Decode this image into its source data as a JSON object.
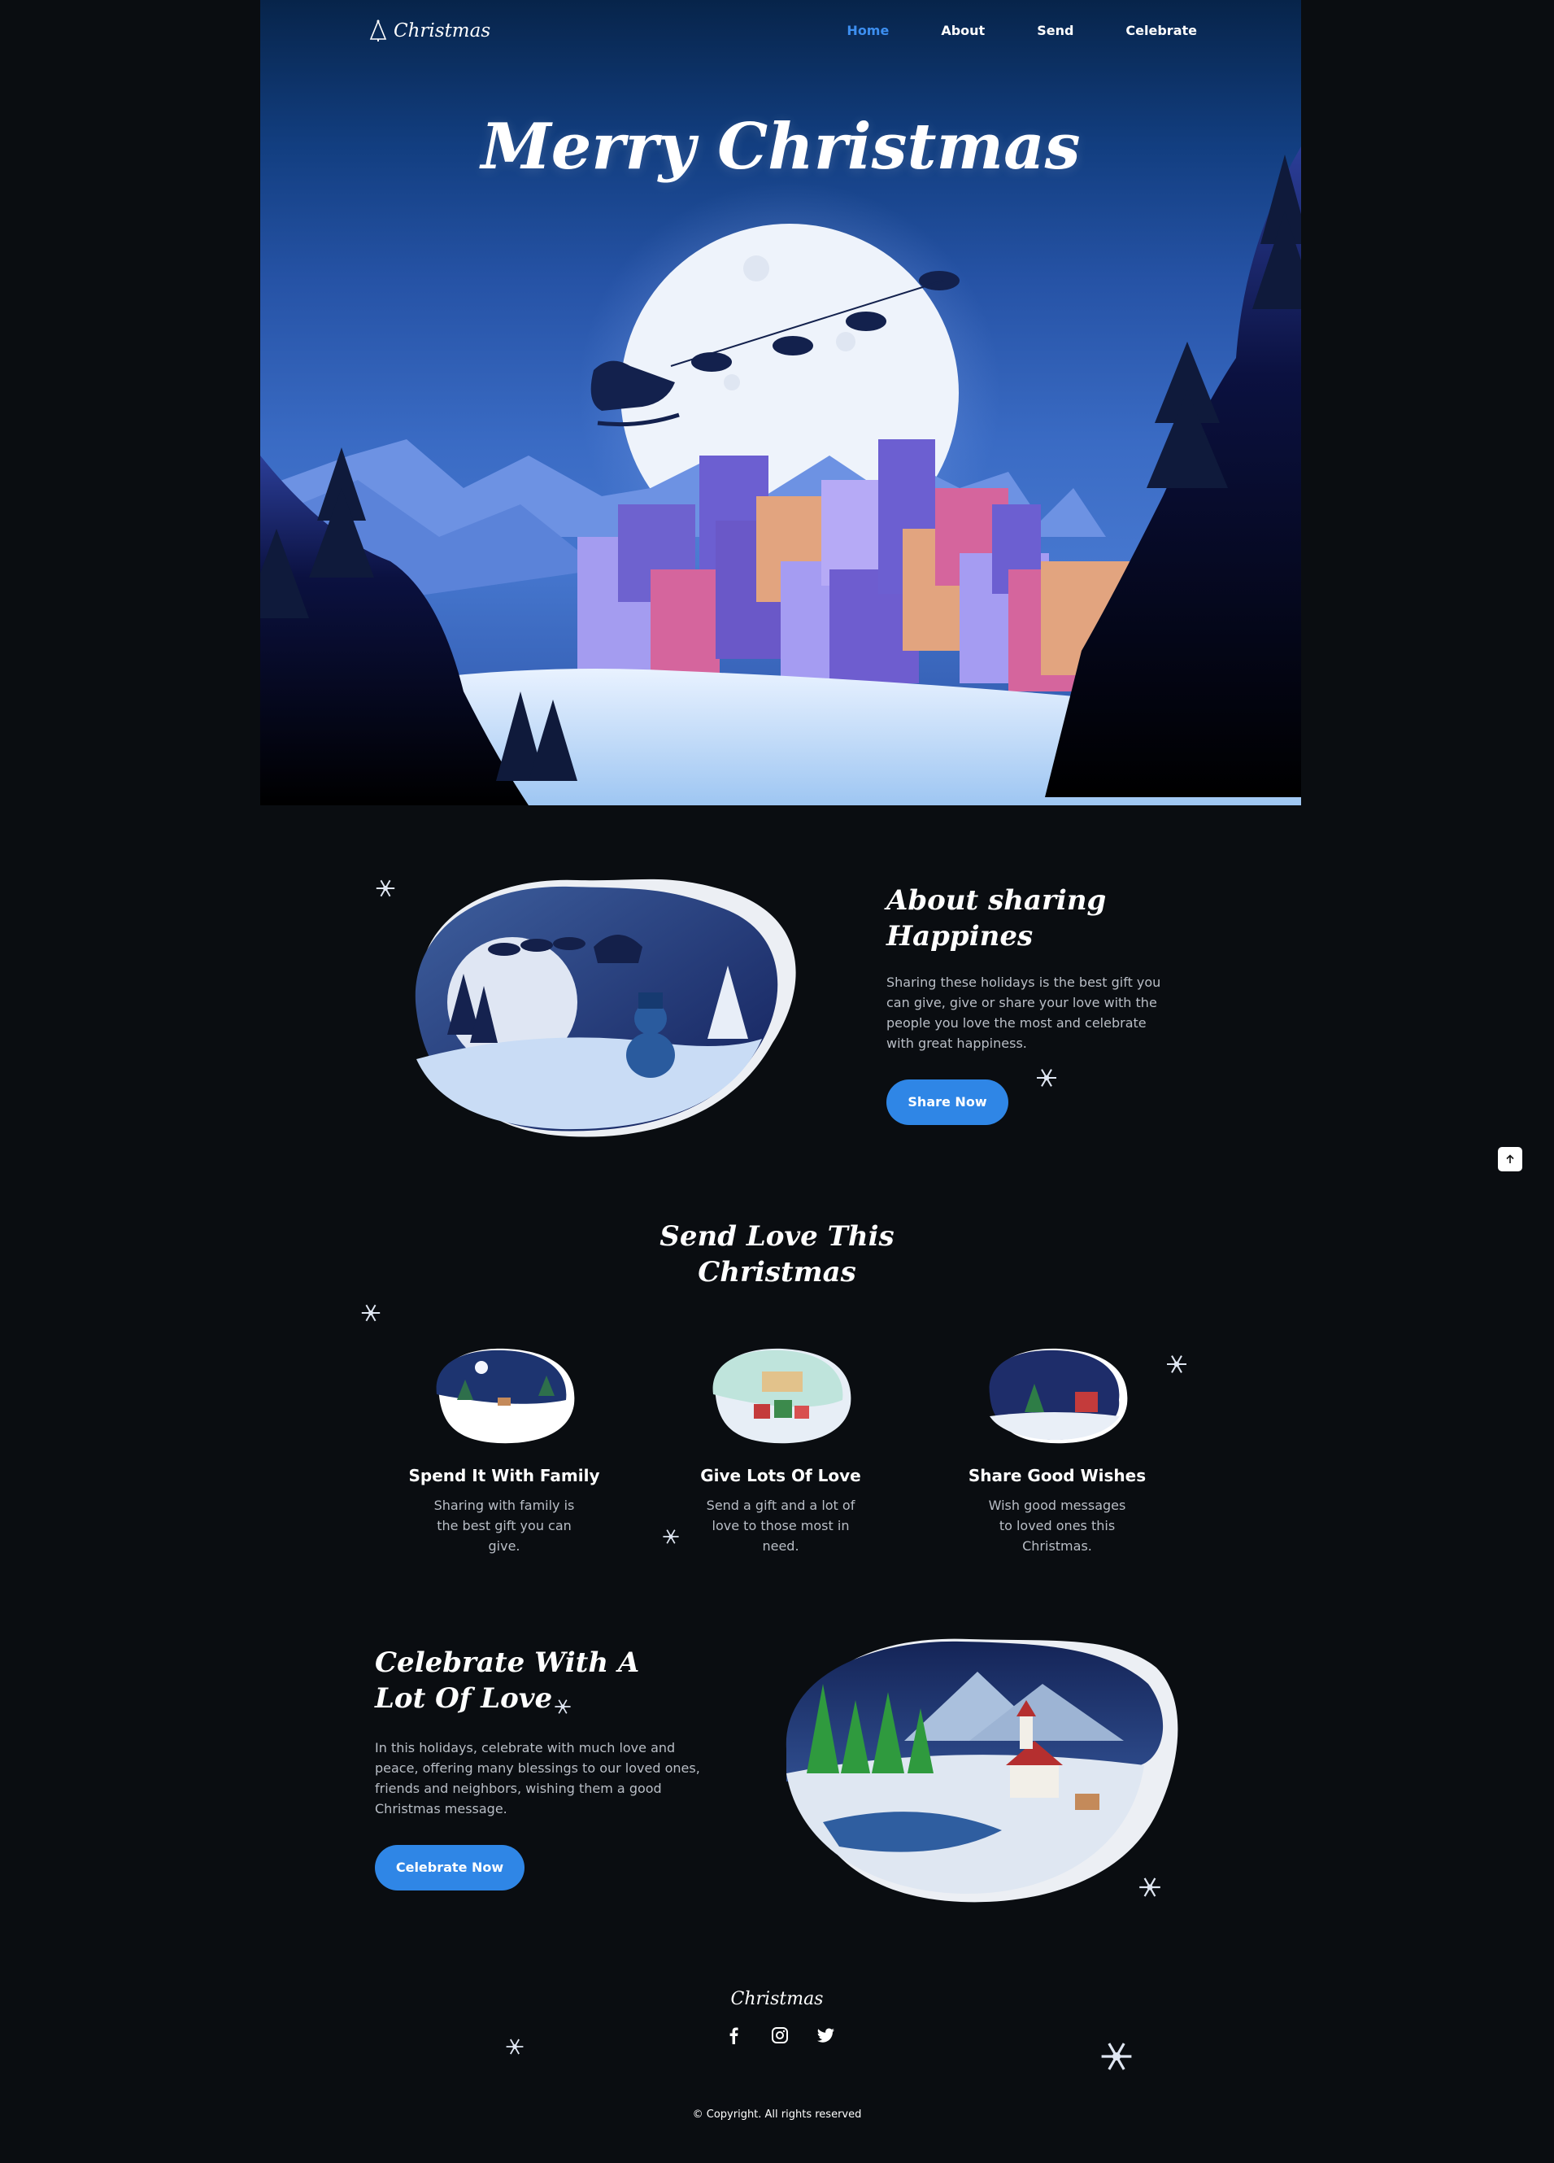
{
  "nav": {
    "logo": "Christmas",
    "links": [
      "Home",
      "About",
      "Send",
      "Celebrate"
    ],
    "active": "Home"
  },
  "hero": {
    "title": "Merry Christmas"
  },
  "about": {
    "title_line1": "About sharing",
    "title_line2": "Happines",
    "text": "Sharing these holidays is the best gift you can give, give or share your love with the people you love the most and celebrate with great happiness.",
    "button": "Share Now"
  },
  "send": {
    "title_line1": "Send Love This",
    "title_line2": "Christmas",
    "cards": [
      {
        "title": "Spend It With Family",
        "text": "Sharing with family is the best gift you can give."
      },
      {
        "title": "Give Lots Of Love",
        "text": "Send a gift and a lot of love to those most in need."
      },
      {
        "title": "Share Good Wishes",
        "text": "Wish good messages to loved ones this Christmas."
      }
    ]
  },
  "celebrate": {
    "title_line1": "Celebrate With A",
    "title_line2": "Lot Of Love",
    "text": "In this holidays, celebrate with much love and peace, offering many blessings to our loved ones, friends and neighbors, wishing them a good Christmas message.",
    "button": "Celebrate Now"
  },
  "footer": {
    "logo": "Christmas",
    "socials": [
      "facebook-icon",
      "instagram-icon",
      "twitter-icon"
    ],
    "copyright": "© Copyright. All rights reserved"
  },
  "colors": {
    "accent": "#2f86e6",
    "active_link": "#3d8ff0",
    "background": "#0a0d11"
  }
}
